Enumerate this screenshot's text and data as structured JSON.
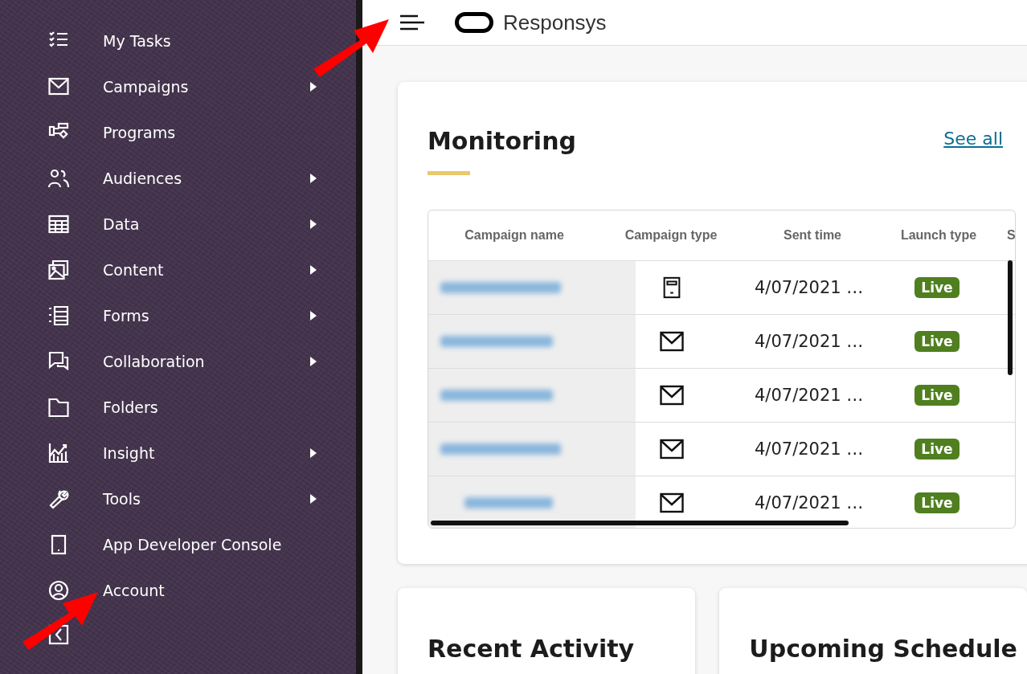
{
  "sidebar": {
    "items": [
      {
        "label": "My Tasks",
        "has_submenu": false
      },
      {
        "label": "Campaigns",
        "has_submenu": true
      },
      {
        "label": "Programs",
        "has_submenu": false
      },
      {
        "label": "Audiences",
        "has_submenu": true
      },
      {
        "label": "Data",
        "has_submenu": true
      },
      {
        "label": "Content",
        "has_submenu": true
      },
      {
        "label": "Forms",
        "has_submenu": true
      },
      {
        "label": "Collaboration",
        "has_submenu": true
      },
      {
        "label": "Folders",
        "has_submenu": false
      },
      {
        "label": "Insight",
        "has_submenu": true
      },
      {
        "label": "Tools",
        "has_submenu": true
      },
      {
        "label": "App Developer Console",
        "has_submenu": false
      },
      {
        "label": "Account",
        "has_submenu": false
      }
    ]
  },
  "header": {
    "app_name": "Responsys"
  },
  "monitoring": {
    "title": "Monitoring",
    "link": "See all",
    "table": {
      "columns": [
        "Campaign name",
        "Campaign type",
        "Sent time",
        "Launch type",
        "S"
      ],
      "rows": [
        {
          "kind": "mobile",
          "sent_time": "4/07/2021 …",
          "launch_type": "Live"
        },
        {
          "kind": "email",
          "sent_time": "4/07/2021 …",
          "launch_type": "Live"
        },
        {
          "kind": "email",
          "sent_time": "4/07/2021 …",
          "launch_type": "Live"
        },
        {
          "kind": "email",
          "sent_time": "4/07/2021 …",
          "launch_type": "Live"
        },
        {
          "kind": "email",
          "sent_time": "4/07/2021 …",
          "launch_type": "Live"
        }
      ]
    }
  },
  "cards": [
    {
      "title": "Recent Activity"
    },
    {
      "title": "Upcoming Schedule"
    }
  ]
}
